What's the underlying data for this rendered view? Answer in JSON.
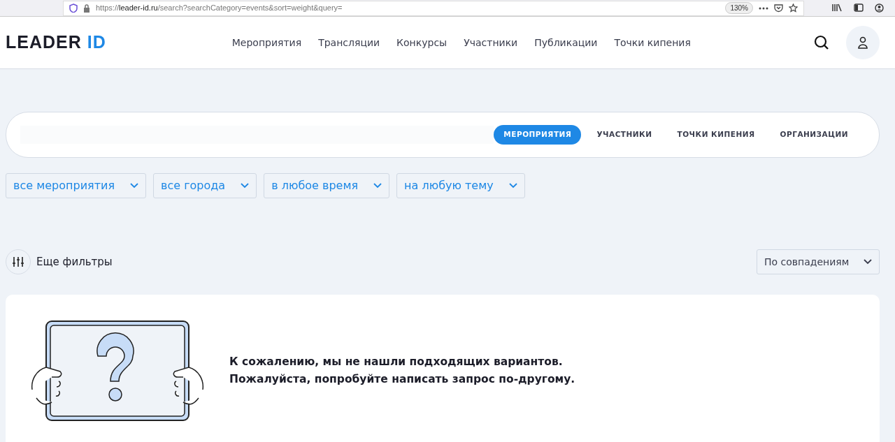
{
  "browser": {
    "url_scheme": "https://",
    "url_host": "leader-id.ru",
    "url_path": "/search?searchCategory=events&sort=weight&query=",
    "zoom": "130%"
  },
  "header": {
    "logo": [
      "LEADER",
      "ID"
    ],
    "nav": [
      "Мероприятия",
      "Трансляции",
      "Конкурсы",
      "Участники",
      "Публикации",
      "Точки кипения"
    ]
  },
  "search": {
    "tabs": [
      {
        "label": "МЕРОПРИЯТИЯ",
        "selected": true
      },
      {
        "label": "УЧАСТНИКИ",
        "selected": false
      },
      {
        "label": "ТОЧКИ КИПЕНИЯ",
        "selected": false
      },
      {
        "label": "ОРГАНИЗАЦИИ",
        "selected": false
      }
    ]
  },
  "filters": [
    "все мероприятия",
    "все города",
    "в любое время",
    "на любую тему"
  ],
  "more_filters": "Еще фильтры",
  "sort": "По совпадениям",
  "empty_message": [
    "К сожалению, мы не нашли подходящих вариантов.",
    "Пожалуйста, попробуйте написать запрос по-другому."
  ]
}
